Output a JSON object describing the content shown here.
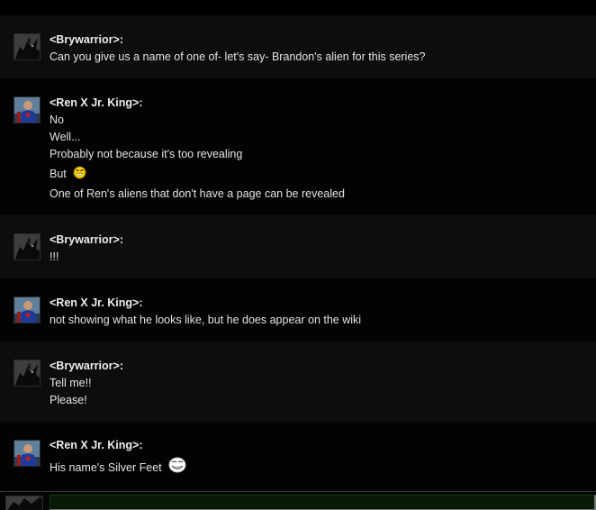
{
  "colors": {
    "background": "#000000",
    "row_alt": "#0d0d0d",
    "row_plain": "#030303",
    "text": "#e4e4e4",
    "input_bg": "#071a07",
    "emote_yellow": "#f5d000"
  },
  "messages": [
    {
      "author": "<Brywarrior>:",
      "avatar": "dark-creature-avatar",
      "lines": [
        "Can you give us a name of one of- let's say- Brandon's alien for this series?"
      ]
    },
    {
      "author": "<Ren X Jr. King>:",
      "avatar": "superhero-avatar",
      "lines": [
        "No",
        "Well...",
        "Probably not because it's too revealing",
        "But",
        "One of Ren's aliens that don't have a page can be revealed"
      ],
      "emote": {
        "after_line": 3,
        "icon": "laughing-emote-icon"
      }
    },
    {
      "author": "<Brywarrior>:",
      "avatar": "dark-creature-avatar",
      "lines": [
        "!!!"
      ]
    },
    {
      "author": "<Ren X Jr. King>:",
      "avatar": "superhero-avatar",
      "lines": [
        "not showing what he looks like, but he does appear on the wiki"
      ]
    },
    {
      "author": "<Brywarrior>:",
      "avatar": "dark-creature-avatar",
      "lines": [
        "Tell me!!",
        "Please!"
      ]
    },
    {
      "author": "<Ren X Jr. King>:",
      "avatar": "superhero-avatar",
      "lines": [
        "His name's Silver Feet"
      ],
      "emote": {
        "after_line": 0,
        "icon": "trollface-emote-icon"
      }
    }
  ],
  "input": {
    "value": "",
    "placeholder": ""
  }
}
